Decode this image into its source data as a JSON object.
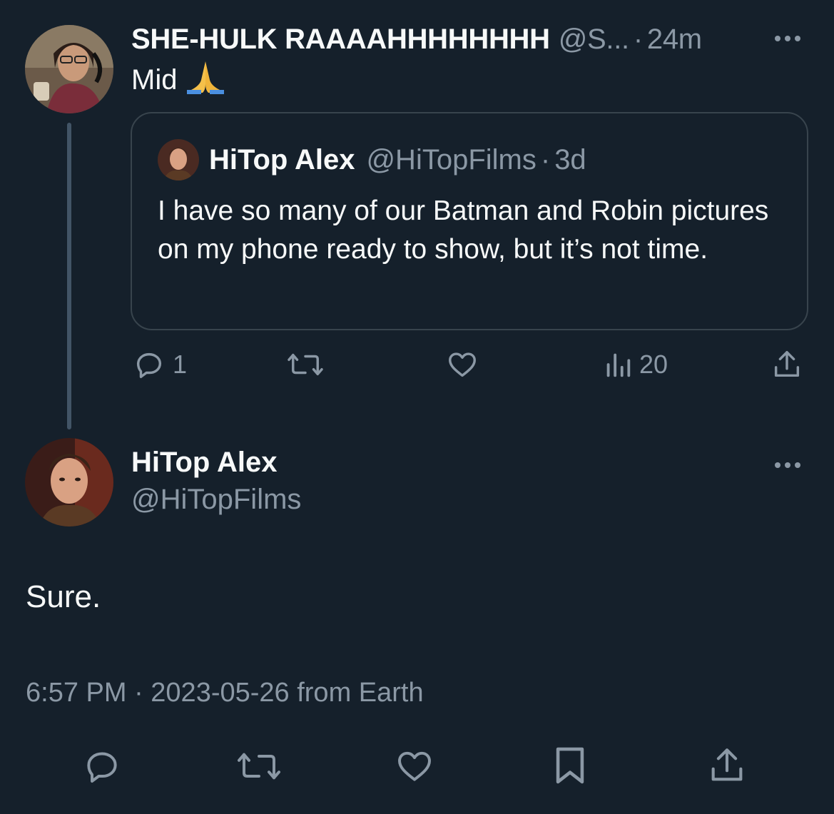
{
  "parent_tweet": {
    "author_name": "SHE-HULK RAAAAHHHHHHHH",
    "author_handle": "@S...",
    "separator": "·",
    "time": "24m",
    "text": "Mid",
    "emoji": "🙏",
    "avatar_icon": "profile-photo-she-hulk",
    "quote": {
      "author_name": "HiTop Alex",
      "author_handle": "@HiTopFilms",
      "separator": "·",
      "time": "3d",
      "text": "I have so many of our Batman and Robin pictures on my phone ready to show, but it’s not time."
    },
    "actions": {
      "reply_count": "1",
      "retweet_count": "",
      "like_count": "",
      "views_count": "20"
    }
  },
  "main_tweet": {
    "author_name": "HiTop Alex",
    "author_handle": "@HiTopFilms",
    "text": "Sure.",
    "meta": "6:57 PM · 2023-05-26 from Earth",
    "avatar_icon": "profile-photo-hitop-alex"
  },
  "colors": {
    "background": "#15202b",
    "primary_text": "#f7f9f9",
    "secondary_text": "#8b98a5",
    "border": "#38444d",
    "thread_line": "#425466"
  }
}
